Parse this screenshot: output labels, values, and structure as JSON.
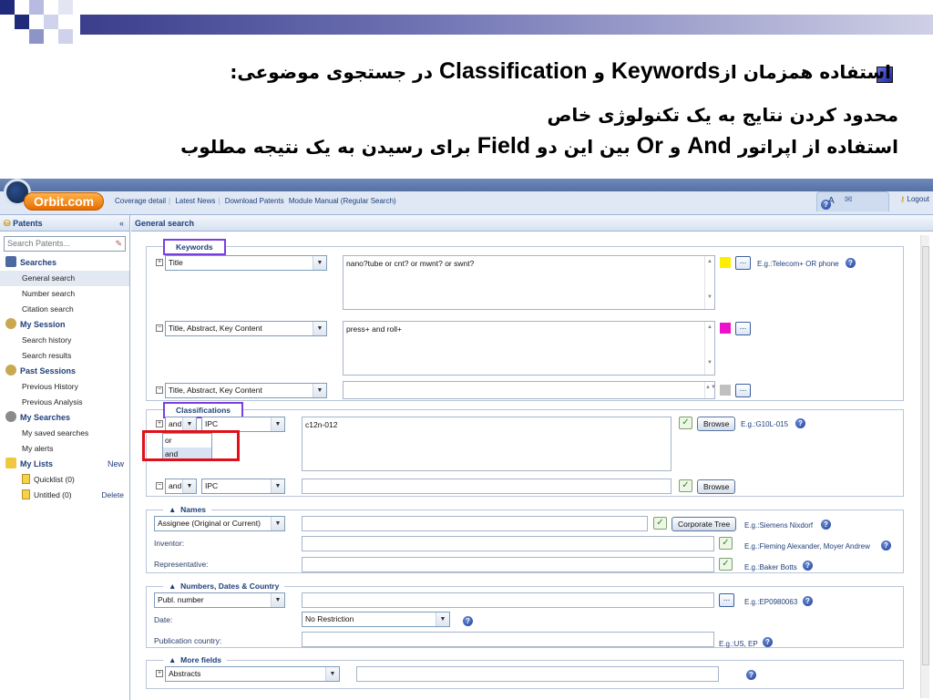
{
  "slide": {
    "line1_before": "استفاده همزمان از",
    "keywords": "Keywords",
    "and_word": "و",
    "classification": "Classification",
    "line1_after": "در جستجوی موضوعی:",
    "line2": "محدود کردن نتایج به یک تکنولوژی خاص",
    "line3_before": "استفاده از اپراتور",
    "op_and": "And",
    "and_word2": "و",
    "op_or": "Or",
    "line3_mid": "بین این دو",
    "field": "Field",
    "line3_after": "برای رسیدن به یک نتیجه مطلوب"
  },
  "header": {
    "logo_text": "Orbit.com",
    "links": [
      "Coverage detail",
      "Latest News",
      "Download Patents",
      "Module Manual (Regular Search)"
    ],
    "logout": "Logout",
    "icons": [
      "help-icon",
      "user-icon",
      "mail-icon",
      "key-icon"
    ]
  },
  "sidebar": {
    "title": "Patents",
    "collapse": "«",
    "search_placeholder": "Search Patents...",
    "sections": [
      {
        "label": "Searches",
        "items": [
          "General search",
          "Number search",
          "Citation search"
        ]
      },
      {
        "label": "My Session",
        "items": [
          "Search history",
          "Search results"
        ]
      },
      {
        "label": "Past Sessions",
        "items": [
          "Previous History",
          "Previous Analysis"
        ]
      },
      {
        "label": "My Searches",
        "items": [
          "My saved searches",
          "My alerts"
        ]
      },
      {
        "label": "My Lists",
        "new": "New",
        "items": [
          "Quicklist (0)",
          "Untitled (0)"
        ],
        "delete": "Delete"
      }
    ]
  },
  "main": {
    "title": "General search",
    "keywords": {
      "legend": "Keywords",
      "rows": [
        {
          "field": "Title",
          "value": "nano?tube or cnt? or mwnt? or swnt?",
          "example": "E.g.:Telecom+ OR phone",
          "color": "#ffee00"
        },
        {
          "field": "Title, Abstract, Key Content",
          "value": "press+ and roll+",
          "color": "#ee11cc"
        },
        {
          "field": "Title, Abstract, Key Content",
          "value": "",
          "color": "#c0c0c0"
        }
      ]
    },
    "classifications": {
      "legend": "Classifications",
      "rows": [
        {
          "op": "and",
          "field": "IPC",
          "value": "c12n-012",
          "button": "Browse",
          "example": "E.g.:G10L-015"
        },
        {
          "op": "and",
          "field": "IPC",
          "value": "",
          "button": "Browse"
        }
      ],
      "dropdown_options": [
        "or",
        "and"
      ]
    },
    "names": {
      "legend": "Names",
      "field": "Assignee (Original or Current)",
      "button": "Corporate Tree",
      "example": "E.g.:Siemens Nixdorf",
      "inventor_label": "Inventor:",
      "inventor_example": "E.g.:Fleming Alexander, Moyer Andrew",
      "representative_label": "Representative:",
      "representative_example": "E.g.:Baker Botts"
    },
    "numbers": {
      "legend": "Numbers, Dates & Country",
      "field": "Publ. number",
      "example": "E.g.:EP0980063",
      "date_label": "Date:",
      "date_value": "No Restriction",
      "country_label": "Publication country:",
      "country_example": "E.g.:US, EP"
    },
    "more": {
      "legend": "More fields",
      "field": "Abstracts"
    }
  }
}
